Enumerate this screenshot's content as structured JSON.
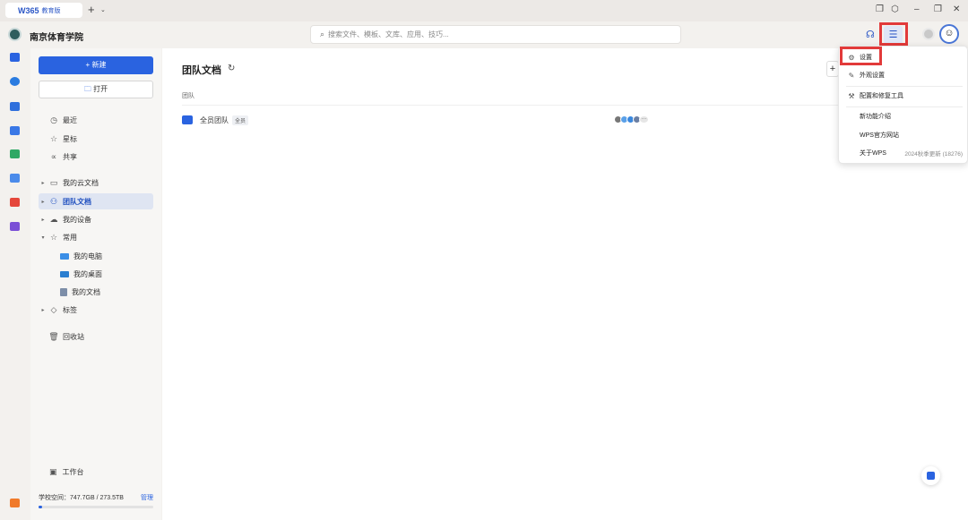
{
  "tab": {
    "logo": "W365",
    "edition": "教育版"
  },
  "header": {
    "school_name": "南京体育学院",
    "search_placeholder": "搜索文件、模板、文库、应用、技巧..."
  },
  "sidebar": {
    "new_label": "+ 新建",
    "open_label": "打开",
    "items": [
      {
        "label": "最近"
      },
      {
        "label": "星标"
      },
      {
        "label": "共享"
      },
      {
        "label": "我的云文档"
      },
      {
        "label": "团队文档"
      },
      {
        "label": "我的设备"
      },
      {
        "label": "常用"
      },
      {
        "label": "我的电脑"
      },
      {
        "label": "我的桌面"
      },
      {
        "label": "我的文档"
      },
      {
        "label": "标签"
      },
      {
        "label": "回收站"
      }
    ],
    "workbench": "工作台",
    "storage_text": "学校空间：747.7GB / 273.5TB",
    "manage": "管理",
    "storage_fraction": 0.03
  },
  "main": {
    "title": "团队文档",
    "section": "团队",
    "team_name": "全员团队",
    "team_badge": "全员",
    "members_more": "···"
  },
  "menu": {
    "items": [
      {
        "label": "设置",
        "icon": "gear-icon"
      },
      {
        "label": "外观设置",
        "icon": "brush-icon"
      },
      {
        "label": "配置和修复工具",
        "icon": "wrench-icon"
      },
      {
        "label": "新功能介绍",
        "icon": ""
      },
      {
        "label": "WPS官方网站",
        "icon": ""
      },
      {
        "label": "关于WPS",
        "icon": "",
        "extra": "2024秋季更新 (18276)"
      }
    ]
  },
  "colors": {
    "accent": "#2a63e0",
    "highlight": "#e23a3a"
  }
}
